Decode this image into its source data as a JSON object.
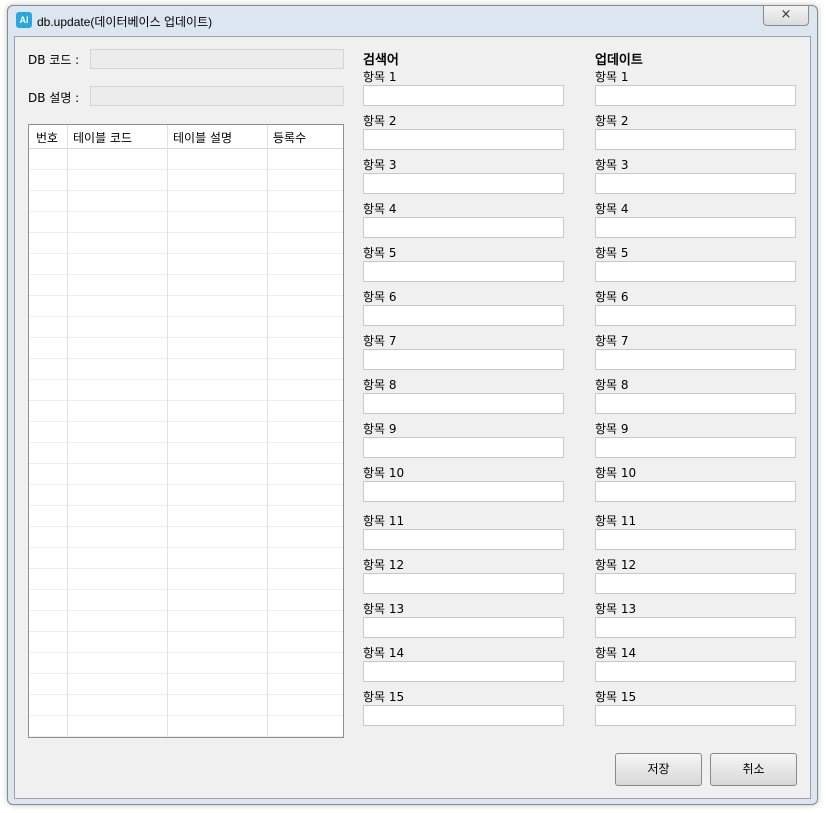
{
  "window": {
    "icon_text": "AI",
    "title": "db.update(데이터베이스 업데이트)",
    "close_glyph": "×"
  },
  "form": {
    "db_code_label": "DB 코드 :",
    "db_code_value": "",
    "db_desc_label": "DB 설명 :",
    "db_desc_value": ""
  },
  "table": {
    "columns": [
      "번호",
      "테이블 코드",
      "테이블 설명",
      "등록수"
    ],
    "rows": []
  },
  "search": {
    "title": "검색어",
    "items": [
      "항목 1",
      "항목 2",
      "항목 3",
      "항목 4",
      "항목 5",
      "항목 6",
      "항목 7",
      "항목 8",
      "항목 9",
      "항목 10",
      "항목 11",
      "항목 12",
      "항목 13",
      "항목 14",
      "항목 15"
    ]
  },
  "update": {
    "title": "업데이트",
    "items": [
      "항목 1",
      "항목 2",
      "항목 3",
      "항목 4",
      "항목 5",
      "항목 6",
      "항목 7",
      "항목 8",
      "항목 9",
      "항목 10",
      "항목 11",
      "항목 12",
      "항목 13",
      "항목 14",
      "항목 15"
    ]
  },
  "buttons": {
    "save": "저장",
    "cancel": "취소"
  }
}
